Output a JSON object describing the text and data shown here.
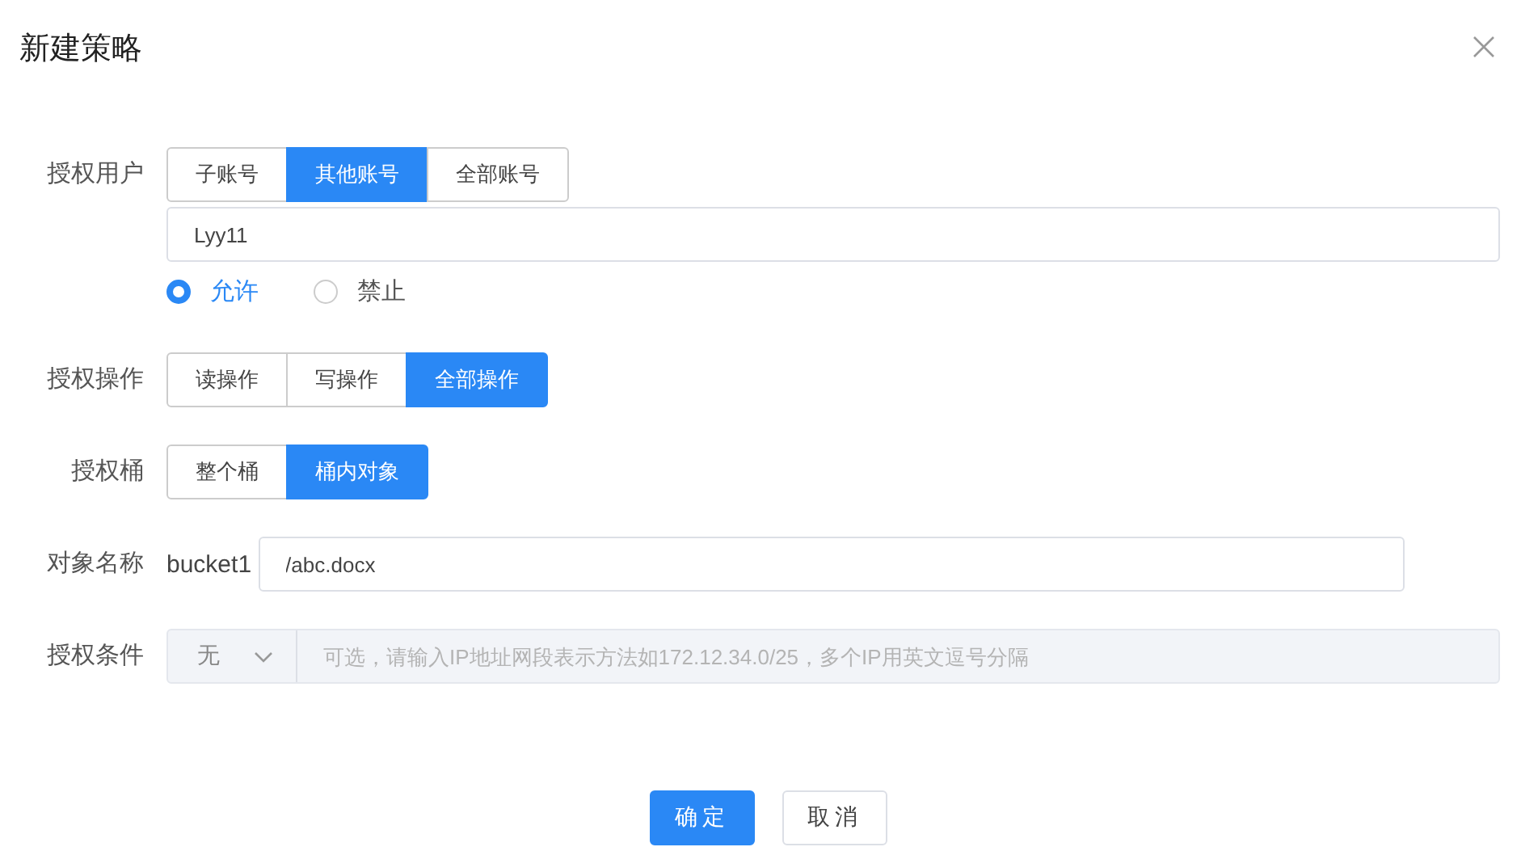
{
  "dialog": {
    "title": "新建策略"
  },
  "fields": [
    {
      "kind": "segmented",
      "label": "授权用户",
      "options": [
        {
          "label": "子账号",
          "selected": false
        },
        {
          "label": "其他账号",
          "selected": true
        },
        {
          "label": "全部账号",
          "selected": false
        }
      ],
      "value": "Lyy11",
      "radios": [
        {
          "label": "允许",
          "selected": true
        },
        {
          "label": "禁止",
          "selected": false
        }
      ]
    },
    {
      "kind": "segmented",
      "label": "授权操作",
      "options": [
        {
          "label": "读操作",
          "selected": false
        },
        {
          "label": "写操作",
          "selected": false
        },
        {
          "label": "全部操作",
          "selected": true
        }
      ]
    },
    {
      "kind": "segmented",
      "label": "授权桶",
      "options": [
        {
          "label": "整个桶",
          "selected": false
        },
        {
          "label": "桶内对象",
          "selected": true
        }
      ]
    },
    {
      "kind": "path",
      "label": "对象名称",
      "prefix": "bucket1",
      "value": "/abc.docx"
    },
    {
      "kind": "condition",
      "label": "授权条件",
      "select": "无",
      "disabled": true,
      "placeholder": "可选，请输入IP地址网段表示方法如172.12.34.0/25，多个IP用英文逗号分隔"
    }
  ],
  "buttons": [
    {
      "label": "确定",
      "kind": "primary"
    },
    {
      "label": "取消",
      "kind": "default"
    }
  ]
}
